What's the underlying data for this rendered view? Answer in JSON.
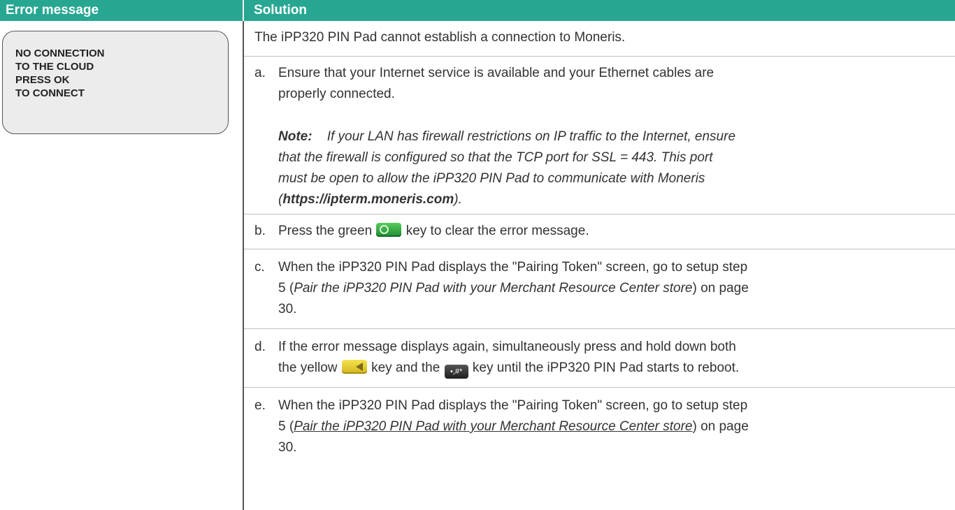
{
  "header": {
    "col1": "Error message",
    "col2": "Solution"
  },
  "lcd": {
    "lines": [
      "NO CONNECTION",
      "TO THE CLOUD",
      "PRESS OK",
      "TO CONNECT"
    ]
  },
  "solution": {
    "intro": "The iPP320 PIN Pad cannot establish a connection to Moneris.",
    "a": {
      "label": "a.",
      "line1": "Ensure that your Internet service is available and your Ethernet cables are",
      "line2": "properly connected."
    },
    "note": {
      "label": "Note:",
      "line1": "If your LAN has firewall restrictions on IP traffic to the Internet, ensure",
      "line2": "that the firewall is configured so that the TCP port for SSL = 443.  This port",
      "line3": "must be open to allow the iPP320 PIN Pad to communicate with Moneris",
      "line4_pre": "(",
      "url": "https://ipterm.moneris.com",
      "line4_post": ")."
    },
    "b": {
      "label": "b.",
      "pre": "Press the green",
      "post": "key to clear the error message."
    },
    "c": {
      "label": "c.",
      "line1": "When the iPP320 PIN Pad displays the \"Pairing Token\" screen, go to setup step",
      "line2_pre": "5 (",
      "link": "Pair the iPP320 PIN Pad with your Merchant Resource Center store",
      "line2_post": ") on page",
      "line3": "30."
    },
    "d": {
      "label": "d.",
      "line1": "If the error message displays again, simultaneously press and hold down both",
      "line2_pre": "the yellow",
      "line2_mid": "key and the",
      "line2_post": "key until the iPP320 PIN Pad starts to reboot."
    },
    "e": {
      "label": "e.",
      "line1": "When the iPP320 PIN Pad displays the \"Pairing Token\" screen, go to setup step",
      "line2_pre": "5 (",
      "link": "Pair the iPP320 PIN Pad with your Merchant Resource Center store",
      "line2_post": ") on page",
      "line3": "30."
    }
  },
  "icons": {
    "green_key": "green-ok-key-icon",
    "yellow_key": "yellow-backspace-key-icon",
    "black_key": "function-key-icon",
    "black_key_glyph": "•,#*"
  }
}
